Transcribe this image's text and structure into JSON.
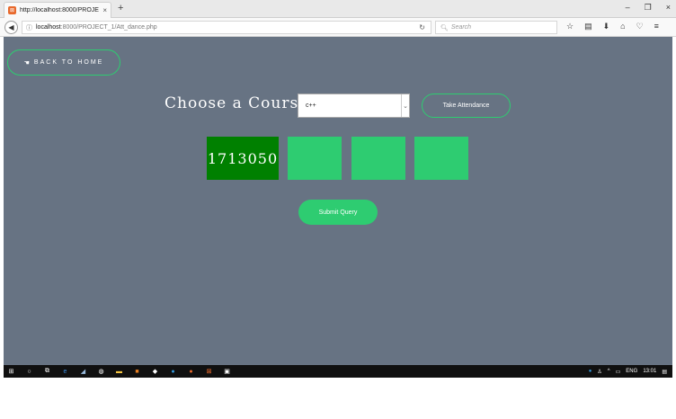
{
  "browser": {
    "tab_title": "http://localhost:8000/PROJE",
    "tab_close": "×",
    "new_tab": "+",
    "url_host": "localhost",
    "url_path": ":8000/PROJECT_1/Att_dance.php",
    "search_placeholder": "Search",
    "window_controls": [
      "–",
      "❐",
      "×"
    ]
  },
  "page": {
    "home_button": "BACK TO HOME",
    "course_label": "Choose a Course:",
    "course_selected": "c++",
    "take_attendance": "Take Attendance",
    "student_boxes": [
      "1713050",
      "",
      "",
      ""
    ],
    "submit": "Submit Query"
  },
  "taskbar": {
    "language": "ENG",
    "time": "13:01"
  },
  "colors": {
    "page_bg": "#677383",
    "accent_green": "#2ecc71",
    "active_green": "#008000"
  }
}
